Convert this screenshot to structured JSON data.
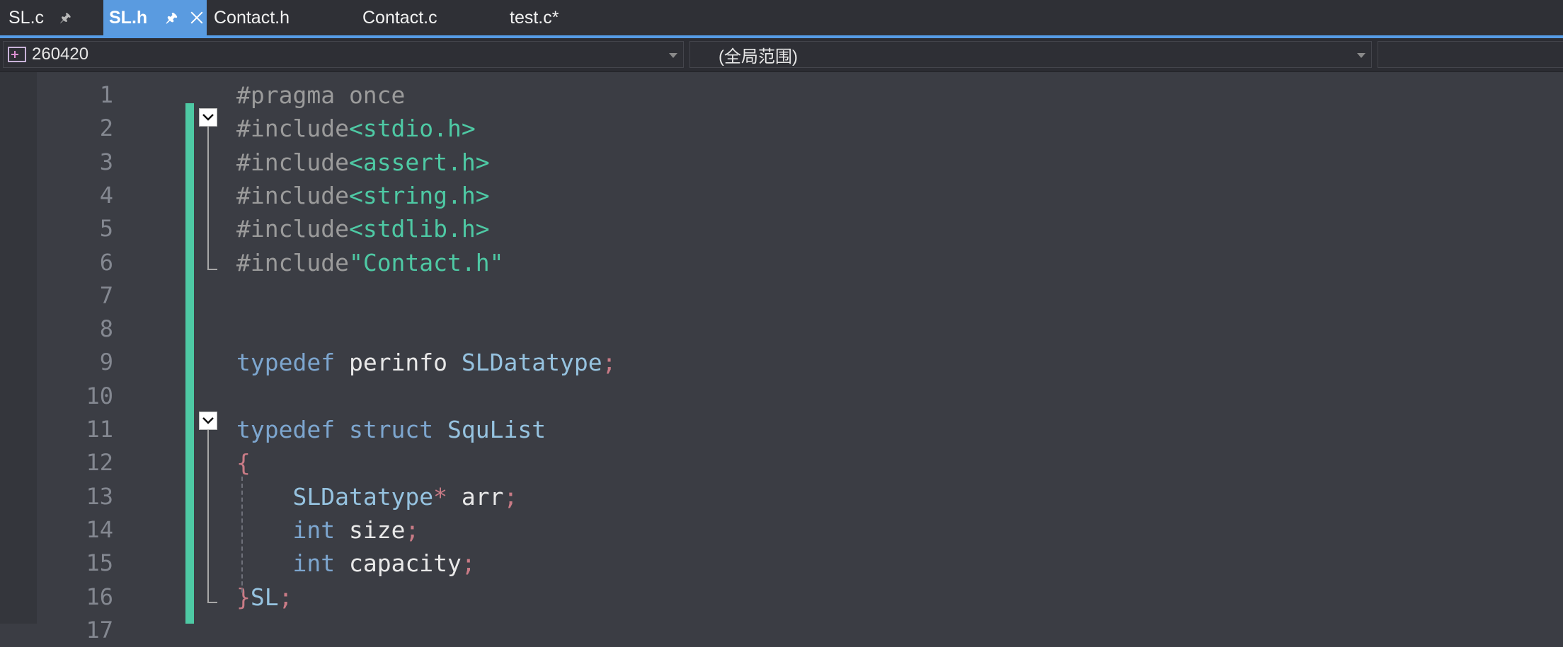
{
  "tabs": [
    {
      "label": "SL.c",
      "pinned": true,
      "active": false
    },
    {
      "label": "SL.h",
      "pinned": true,
      "active": true
    },
    {
      "label": "Contact.h",
      "active": false
    },
    {
      "label": "Contact.c",
      "active": false
    },
    {
      "label": "test.c*",
      "active": false
    }
  ],
  "nav": {
    "project": "260420",
    "scope": "(全局范围)",
    "member": ""
  },
  "icons": {
    "pin": "pin-icon",
    "close": "close-icon",
    "project": "project-icon",
    "dropdown": "chevron-down-icon",
    "fold": "collapse-icon"
  },
  "colors": {
    "active_tab": "#5a9be0",
    "change_bar": "#4ec9a4",
    "string": "#4ec9a4",
    "keyword": "#7da6cf",
    "type": "#96c3e0",
    "preprocessor": "#9b9b9b",
    "punctuation": "#c97b86",
    "editor_bg": "#3b3d44"
  },
  "editor": {
    "line_numbers": [
      "1",
      "2",
      "3",
      "4",
      "5",
      "6",
      "7",
      "8",
      "9",
      "10",
      "11",
      "12",
      "13",
      "14",
      "15",
      "16",
      "17"
    ],
    "lines": [
      [
        {
          "t": "#pragma once",
          "c": "pre"
        }
      ],
      [
        {
          "t": "#include",
          "c": "pre"
        },
        {
          "t": "<stdio.h>",
          "c": "str"
        }
      ],
      [
        {
          "t": "#include",
          "c": "pre"
        },
        {
          "t": "<assert.h>",
          "c": "str"
        }
      ],
      [
        {
          "t": "#include",
          "c": "pre"
        },
        {
          "t": "<string.h>",
          "c": "str"
        }
      ],
      [
        {
          "t": "#include",
          "c": "pre"
        },
        {
          "t": "<stdlib.h>",
          "c": "str"
        }
      ],
      [
        {
          "t": "#include",
          "c": "pre"
        },
        {
          "t": "\"Contact.h\"",
          "c": "str"
        }
      ],
      [],
      [],
      [
        {
          "t": "typedef",
          "c": "kw"
        },
        {
          "t": " "
        },
        {
          "t": "perinfo",
          "c": "id"
        },
        {
          "t": " "
        },
        {
          "t": "SLDatatype",
          "c": "type"
        },
        {
          "t": ";",
          "c": "punc"
        }
      ],
      [],
      [
        {
          "t": "typedef",
          "c": "kw"
        },
        {
          "t": " "
        },
        {
          "t": "struct",
          "c": "kw"
        },
        {
          "t": " "
        },
        {
          "t": "SquList",
          "c": "type"
        }
      ],
      [
        {
          "t": "{",
          "c": "punc"
        }
      ],
      [
        {
          "t": "    "
        },
        {
          "t": "SLDatatype",
          "c": "type"
        },
        {
          "t": "*",
          "c": "punc"
        },
        {
          "t": " "
        },
        {
          "t": "arr",
          "c": "id"
        },
        {
          "t": ";",
          "c": "punc"
        }
      ],
      [
        {
          "t": "    "
        },
        {
          "t": "int",
          "c": "kw"
        },
        {
          "t": " "
        },
        {
          "t": "size",
          "c": "id"
        },
        {
          "t": ";",
          "c": "punc"
        }
      ],
      [
        {
          "t": "    "
        },
        {
          "t": "int",
          "c": "kw"
        },
        {
          "t": " "
        },
        {
          "t": "capacity",
          "c": "id"
        },
        {
          "t": ";",
          "c": "punc"
        }
      ],
      [
        {
          "t": "}",
          "c": "punc"
        },
        {
          "t": "SL",
          "c": "type"
        },
        {
          "t": ";",
          "c": "punc"
        }
      ],
      []
    ]
  }
}
